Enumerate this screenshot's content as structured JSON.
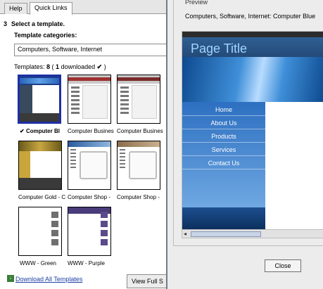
{
  "tabs": {
    "help": "Help",
    "quick_links": "Quick Links"
  },
  "step": {
    "number": "3",
    "text": "Select a template."
  },
  "categories": {
    "label": "Template categories:",
    "selected": "Computers, Software, Internet"
  },
  "templates_summary": {
    "prefix": "Templates: ",
    "count": "8",
    "open": " ( ",
    "downloaded_count": "1",
    "downloaded_label": " downloaded",
    "check": "✔",
    "close": " )"
  },
  "templates": [
    {
      "label": "Computer Bl",
      "check": "✔"
    },
    {
      "label": "Computer Busines"
    },
    {
      "label": "Computer Busines"
    },
    {
      "label": "Computer Gold - C"
    },
    {
      "label": "Computer Shop -"
    },
    {
      "label": "Computer Shop -"
    },
    {
      "label": "WWW - Green"
    },
    {
      "label": "WWW - Purple"
    }
  ],
  "download_all": "Download All Templates",
  "view_full": "View Full S",
  "preview": {
    "legend": "Preview",
    "caption": "Computers, Software, Internet: Computer Blue",
    "page_title": "Page Title",
    "menu": [
      "Home",
      "About Us",
      "Products",
      "Services",
      "Contact Us"
    ],
    "close": "Close"
  },
  "colors": {
    "selection": "#1d2fa3",
    "link": "#1d3fa3",
    "preview_menu": "#2d6fc1"
  }
}
